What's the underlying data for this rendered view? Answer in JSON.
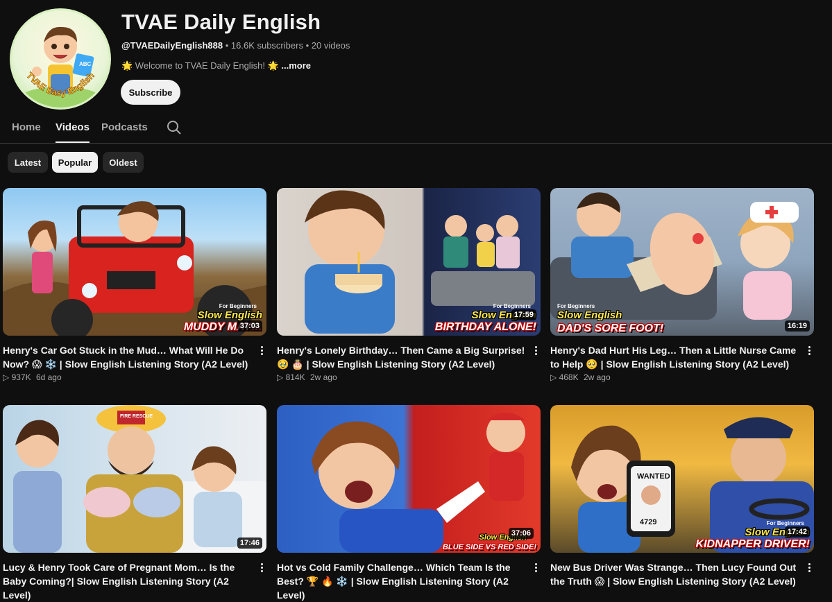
{
  "channel": {
    "name": "TVAE Daily English",
    "handle": "@TVAEDailyEnglish888",
    "subscribers": "16.6K subscribers",
    "video_count": "20 videos",
    "description": "🌟 Welcome to TVAE Daily English! 🌟",
    "more_label": "...more",
    "subscribe_label": "Subscribe",
    "avatar_text": "TVAE Easy English"
  },
  "tabs": [
    {
      "label": "Home"
    },
    {
      "label": "Videos"
    },
    {
      "label": "Podcasts"
    }
  ],
  "chips": [
    {
      "label": "Latest"
    },
    {
      "label": "Popular"
    },
    {
      "label": "Oldest"
    }
  ],
  "videos": [
    {
      "title": "Henry's Car Got Stuck in the Mud… What Will He Do Now? 😱 ❄️ | Slow English Listening Story (A2 Level)",
      "views": "▷ 937K",
      "age": "6d ago",
      "duration": "37:03",
      "badge": "For Beginners",
      "thumb_sub": "Slow English",
      "thumb_caption": "MUDDY MAY…"
    },
    {
      "title": "Henry's Lonely Birthday… Then Came a Big Surprise! 🥹 🎂 | Slow English Listening Story (A2 Level)",
      "views": "▷ 814K",
      "age": "2w ago",
      "duration": "17:59",
      "badge": "For Beginners",
      "thumb_sub": "Slow English",
      "thumb_caption": "BIRTHDAY ALONE!"
    },
    {
      "title": "Henry's Dad Hurt His Leg… Then a Little Nurse Came to Help 🥺 | Slow English Listening Story (A2 Level)",
      "views": "▷ 468K",
      "age": "2w ago",
      "duration": "16:19",
      "badge": "For Beginners",
      "thumb_sub": "Slow English",
      "thumb_caption": "DAD'S SORE FOOT!"
    },
    {
      "title": "Lucy & Henry Took Care of Pregnant Mom… Is the Baby Coming?| Slow English Listening Story (A2 Level)",
      "duration": "17:46",
      "thumb_sub": "",
      "thumb_caption": "",
      "sign": "FIRE RESCUE"
    },
    {
      "title": "Hot vs Cold Family Challenge… Which Team Is the Best? 🏆 🔥 ❄️ | Slow English Listening Story (A2 Level)",
      "duration": "37:06",
      "thumb_sub": "Slow English",
      "thumb_caption": "BLUE SIDE VS RED SIDE!"
    },
    {
      "title": "New Bus Driver Was Strange… Then Lucy Found Out the Truth 😱 | Slow English Listening Story (A2 Level)",
      "duration": "17:42",
      "badge": "For Beginners",
      "thumb_sub": "Slow English",
      "thumb_caption": "KIDNAPPER DRIVER!",
      "wanted": "WANTED",
      "wanted_number": "4729"
    }
  ],
  "colors": {
    "background": "#0f0f0f",
    "text_primary": "#f1f1f1",
    "text_secondary": "#aaaaaa",
    "chip_bg": "#272727"
  }
}
